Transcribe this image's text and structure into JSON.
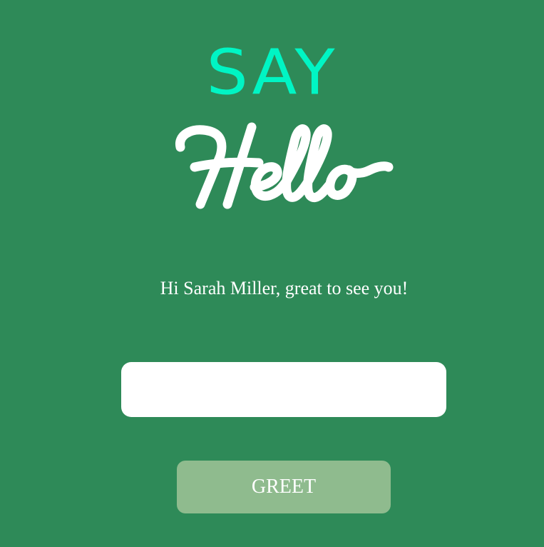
{
  "colors": {
    "background": "#2e8a58",
    "logo_say": "#00f5c4",
    "logo_hello": "#ffffff",
    "button_bg": "#8fbb8e",
    "input_bg": "#ffffff"
  },
  "logo": {
    "say": "SAY",
    "hello": "Hello"
  },
  "message": "Hi Sarah Miller, great to see you!",
  "input": {
    "value": "",
    "placeholder": ""
  },
  "button": {
    "label": "GREET"
  }
}
